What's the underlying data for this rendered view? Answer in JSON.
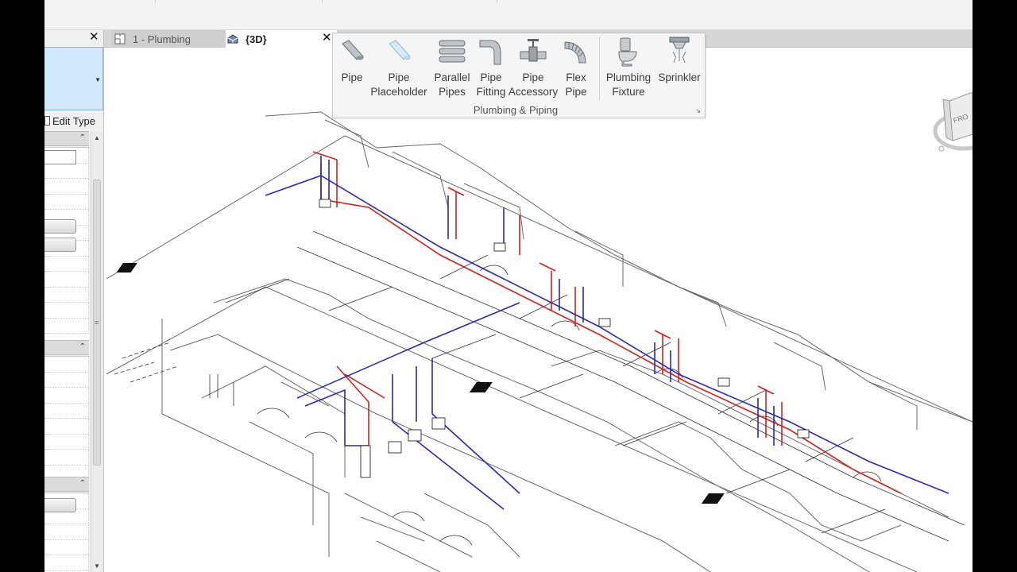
{
  "tabs": [
    {
      "label": "1 - Plumbing"
    },
    {
      "label": "{3D}"
    }
  ],
  "properties": {
    "edit_type_label": "Edit Type"
  },
  "ribbon": {
    "panel_title": "Plumbing & Piping",
    "buttons": [
      {
        "icon": "pipe-icon",
        "line1": "Pipe",
        "line2": ""
      },
      {
        "icon": "pipe-placeholder-icon",
        "line1": "Pipe",
        "line2": "Placeholder"
      },
      {
        "icon": "parallel-pipes-icon",
        "line1": "Parallel",
        "line2": "Pipes"
      },
      {
        "icon": "pipe-fitting-icon",
        "line1": "Pipe",
        "line2": "Fitting"
      },
      {
        "icon": "pipe-accessory-icon",
        "line1": "Pipe",
        "line2": "Accessory"
      },
      {
        "icon": "flex-pipe-icon",
        "line1": "Flex",
        "line2": "Pipe"
      },
      {
        "icon": "plumbing-fixture-icon",
        "line1": "Plumbing",
        "line2": "Fixture"
      },
      {
        "icon": "sprinkler-icon",
        "line1": "Sprinkler",
        "line2": ""
      }
    ]
  },
  "colors": {
    "hot_water": "#d22020",
    "cold_water": "#2a2ab8",
    "linework": "#222222",
    "type_selector": "#cfe8fb"
  },
  "viewcube": {
    "face_label": "FRO"
  }
}
